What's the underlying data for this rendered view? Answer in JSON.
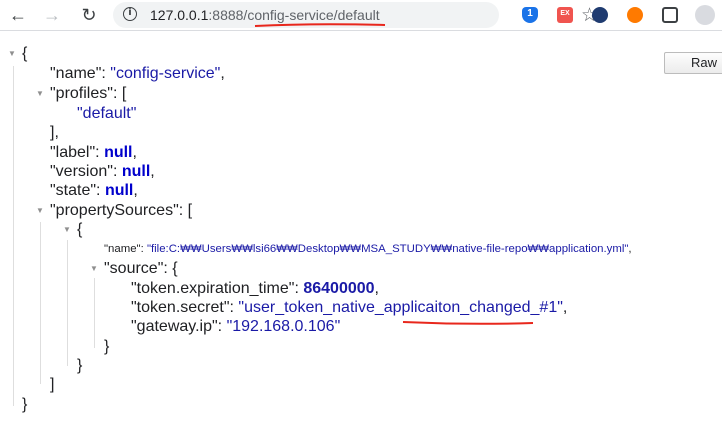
{
  "browser": {
    "url_host": "127.0.0.1",
    "url_rest": ":8888/config-service/default"
  },
  "raw_button_label": "Raw",
  "json": {
    "k_name": "\"name\"",
    "v_name": "\"config-service\"",
    "k_profiles": "\"profiles\"",
    "v_profile_0": "\"default\"",
    "k_label": "\"label\"",
    "k_version": "\"version\"",
    "k_state": "\"state\"",
    "null": "null",
    "k_propertySources": "\"propertySources\"",
    "ps_k_name": "\"name\"",
    "ps_v_name": "\"file:C:₩₩Users₩₩lsi66₩₩Desktop₩₩MSA_STUDY₩₩native-file-repo₩₩application.yml\"",
    "ps_k_source": "\"source\"",
    "k_token_exp": "\"token.expiration_time\"",
    "v_token_exp": "86400000",
    "k_token_secret": "\"token.secret\"",
    "v_token_secret": "\"user_token_native_applicaiton_changed_#1\"",
    "k_gateway_ip": "\"gateway.ip\"",
    "v_gateway_ip": "\"192.168.0.106\""
  },
  "colors": {
    "string": "#1a1aa6",
    "keyword": "#0000cc",
    "annotation": "#e8271c"
  }
}
